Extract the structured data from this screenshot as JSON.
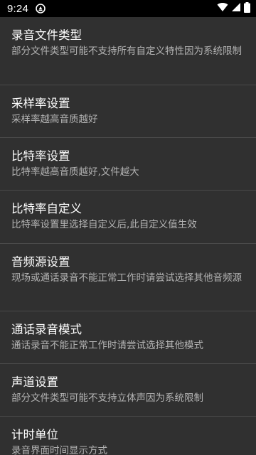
{
  "status_bar": {
    "time": "9:24",
    "icons": [
      "notification-icon",
      "wifi-icon",
      "signal-icon",
      "battery-icon"
    ]
  },
  "colors": {
    "background": "#303030",
    "divider": "#4a4a4a",
    "title": "#ffffff",
    "summary": "#b3b3b3",
    "status_bar": "#000000"
  },
  "settings": [
    {
      "title": "录音文件类型",
      "summary": "部分文件类型可能不支持所有自定义特性因为系统限制"
    },
    {
      "title": "采样率设置",
      "summary": "采样率越高音质越好"
    },
    {
      "title": "比特率设置",
      "summary": "比特率越高音质越好,文件越大"
    },
    {
      "title": "比特率自定义",
      "summary": "比特率设置里选择自定义后,此自定义值生效"
    },
    {
      "title": "音频源设置",
      "summary": "现场或通话录音不能正常工作时请尝试选择其他音频源"
    },
    {
      "title": "通话录音模式",
      "summary": "通话录音不能正常工作时请尝试选择其他模式"
    },
    {
      "title": "声道设置",
      "summary": "部分文件类型可能不支持立体声因为系统限制"
    },
    {
      "title": "计时单位",
      "summary": "录音界面时间显示方式"
    }
  ]
}
